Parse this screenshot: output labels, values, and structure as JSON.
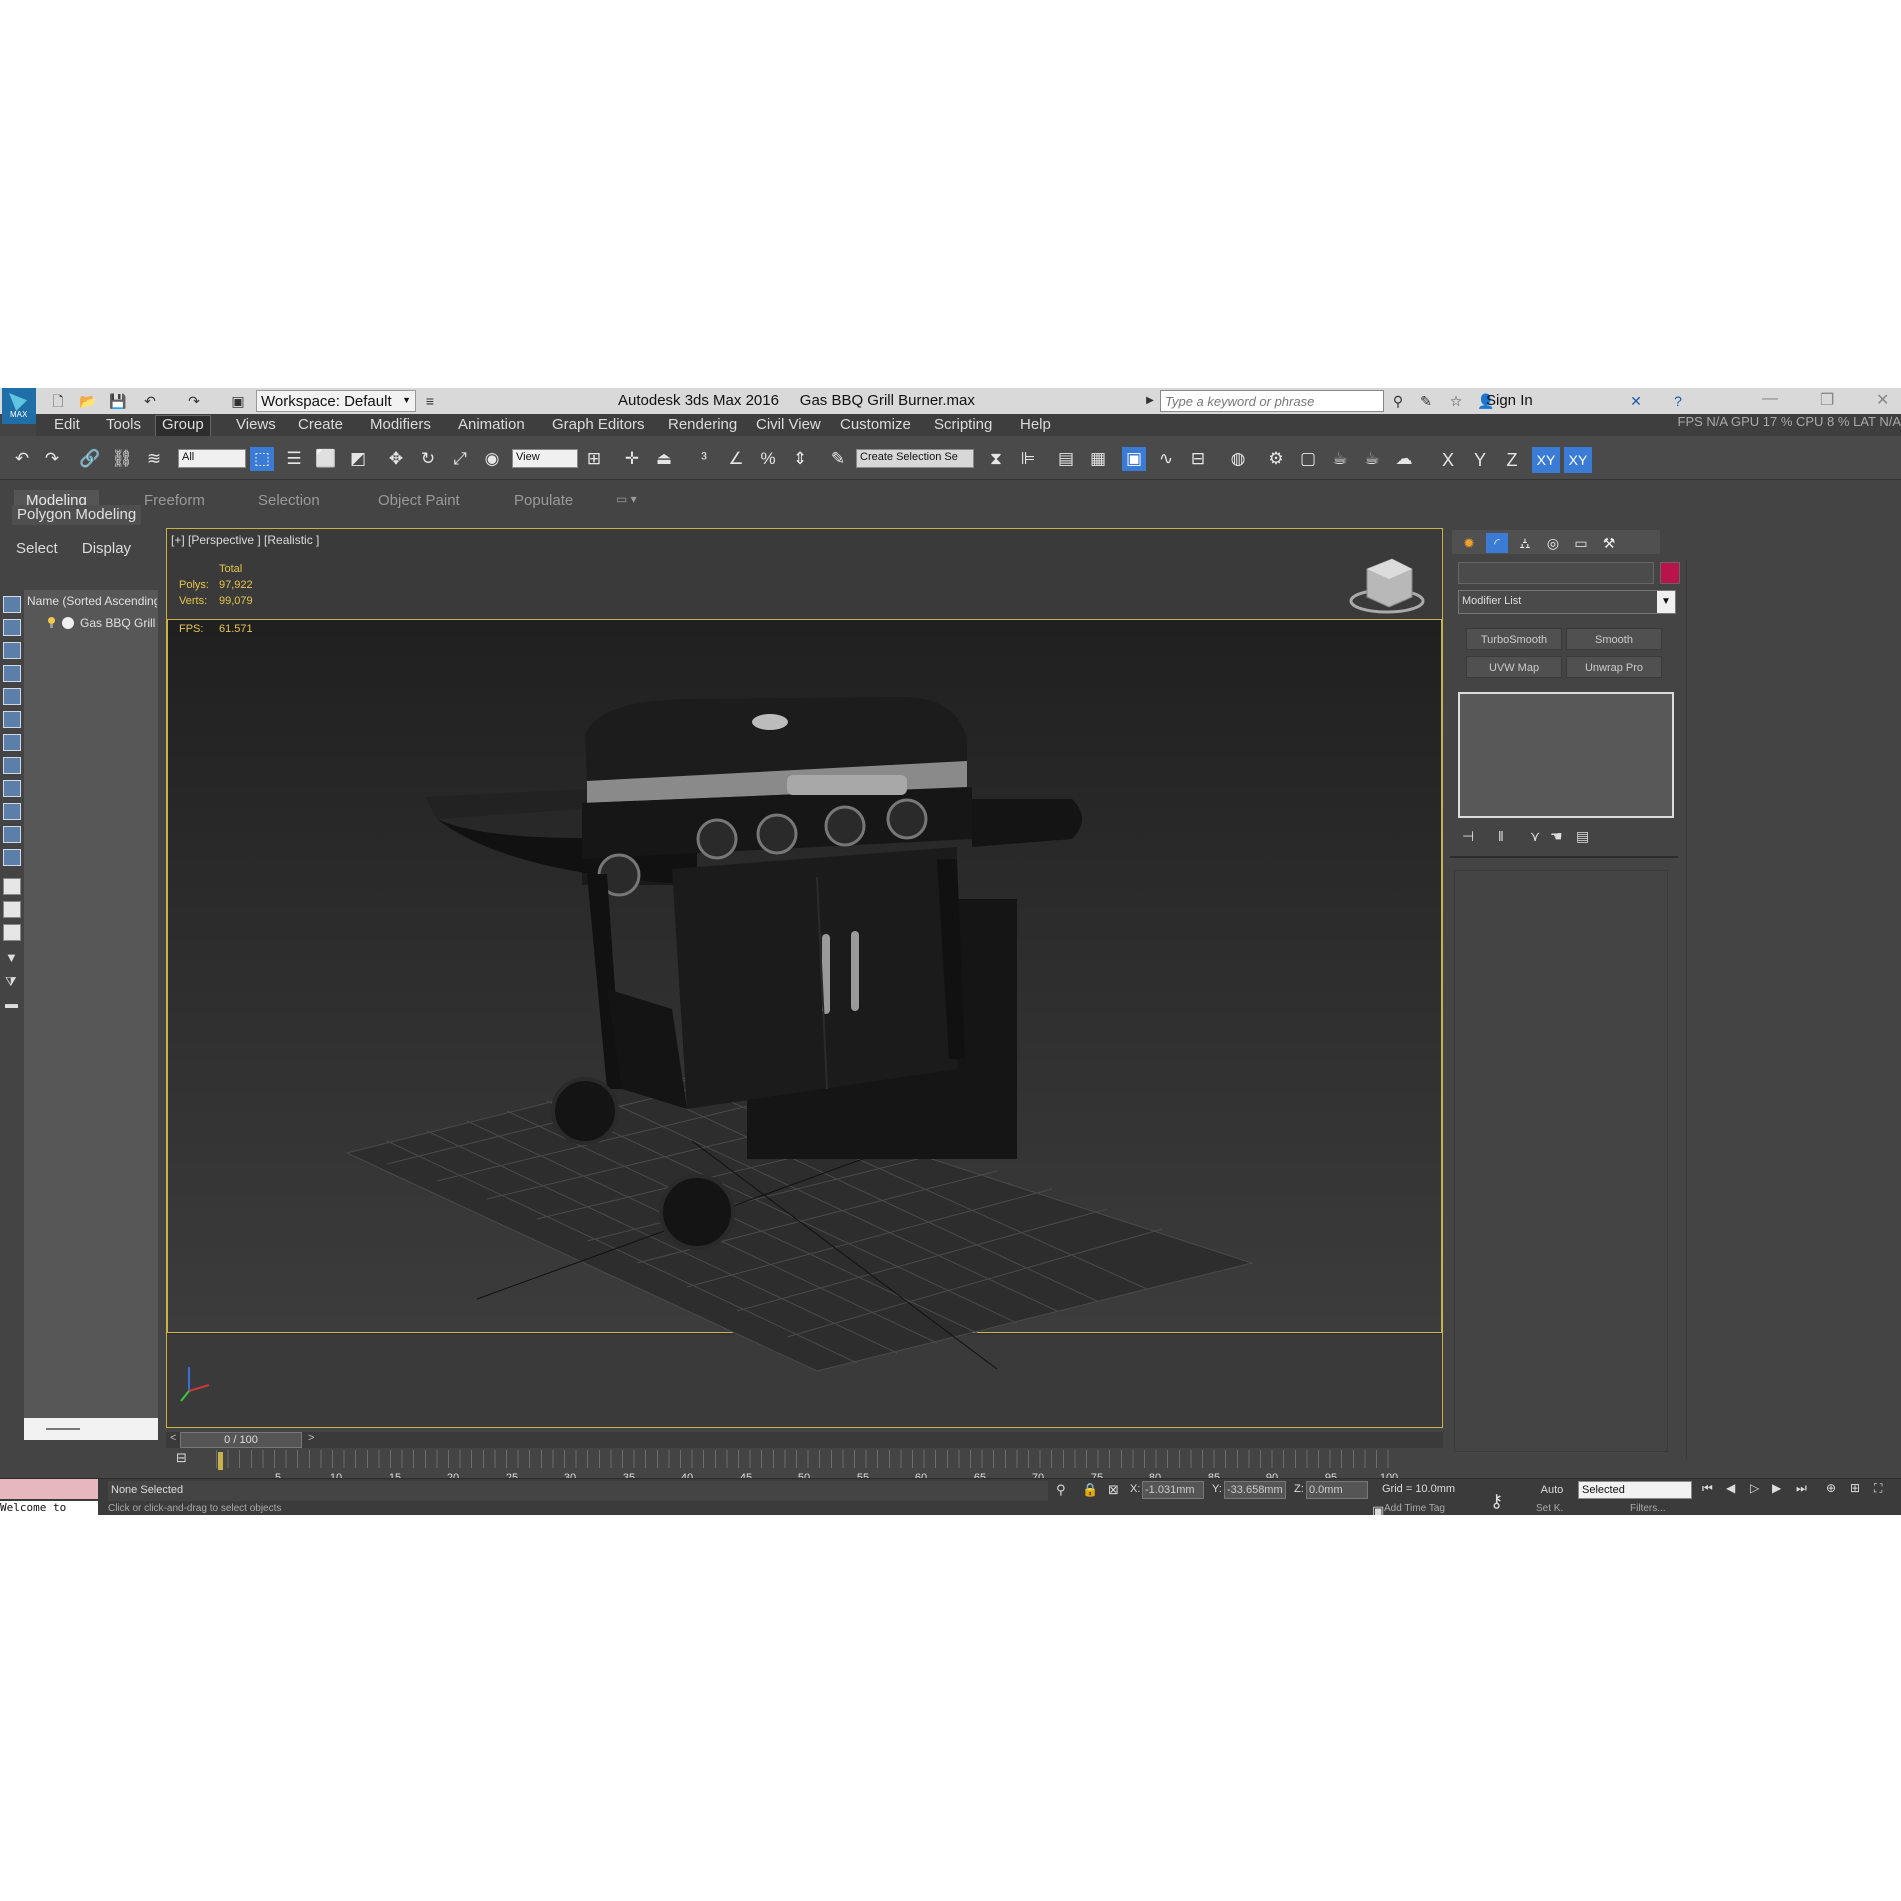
{
  "titlebar": {
    "logo_text": "MAX",
    "workspace": "Workspace: Default",
    "app_title": "Autodesk 3ds Max 2016",
    "file_name": "Gas BBQ Grill Burner.max",
    "search_placeholder": "Type a keyword or phrase",
    "sign_in": "Sign In"
  },
  "menu": {
    "items": [
      "Edit",
      "Tools",
      "Group",
      "Views",
      "Create",
      "Modifiers",
      "Animation",
      "Graph Editors",
      "Rendering",
      "Civil View",
      "Customize",
      "Scripting",
      "Help"
    ],
    "active": "Group",
    "status_right": "FPS  N/A     GPU  17 %     CPU  8 %     LAT  N/A"
  },
  "toolbar": {
    "selection_filter": "All",
    "ref_coord": "View",
    "selection_set_placeholder": "Create Selection Se",
    "axes": [
      "X",
      "Y",
      "Z",
      "XY",
      "XY"
    ]
  },
  "ribbon": {
    "tabs": [
      "Modeling",
      "Freeform",
      "Selection",
      "Object Paint",
      "Populate"
    ],
    "active_tab": "Modeling",
    "panel_label": "Polygon Modeling"
  },
  "explorer": {
    "tabs": [
      "Select",
      "Display"
    ],
    "column_header": "Name (Sorted Ascending)",
    "items": [
      "Gas BBQ Grill"
    ]
  },
  "viewport": {
    "label": "[+] [Perspective ] [Realistic ]",
    "stats": {
      "total_label": "Total",
      "polys_label": "Polys:",
      "polys_value": "97,922",
      "verts_label": "Verts:",
      "verts_value": "99,079",
      "fps_label": "FPS:",
      "fps_value": "61.571"
    }
  },
  "command_panel": {
    "modifier_list": "Modifier List",
    "modifier_buttons": [
      "TurboSmooth",
      "Smooth",
      "UVW Map",
      "Unwrap Pro"
    ],
    "object_color": "#b8134a"
  },
  "timeline": {
    "frame_display": "0 / 100",
    "ticks": [
      "5",
      "10",
      "15",
      "20",
      "25",
      "30",
      "35",
      "40",
      "45",
      "50",
      "55",
      "60",
      "65",
      "70",
      "75",
      "80",
      "85",
      "90",
      "95",
      "100"
    ]
  },
  "statusbar": {
    "maxscript_text": "Welcome to",
    "selection_status": "None Selected",
    "hint": "Click or click-and-drag to select objects",
    "x_label": "X:",
    "x_value": "-1.031mm",
    "y_label": "Y:",
    "y_value": "-33.658mm",
    "z_label": "Z:",
    "z_value": "0.0mm",
    "grid": "Grid = 10.0mm",
    "auto_key": "Auto",
    "set_key": "Set K.",
    "key_filter": "Selected",
    "filters": "Filters...",
    "add_time_tag": "Add Time Tag"
  }
}
